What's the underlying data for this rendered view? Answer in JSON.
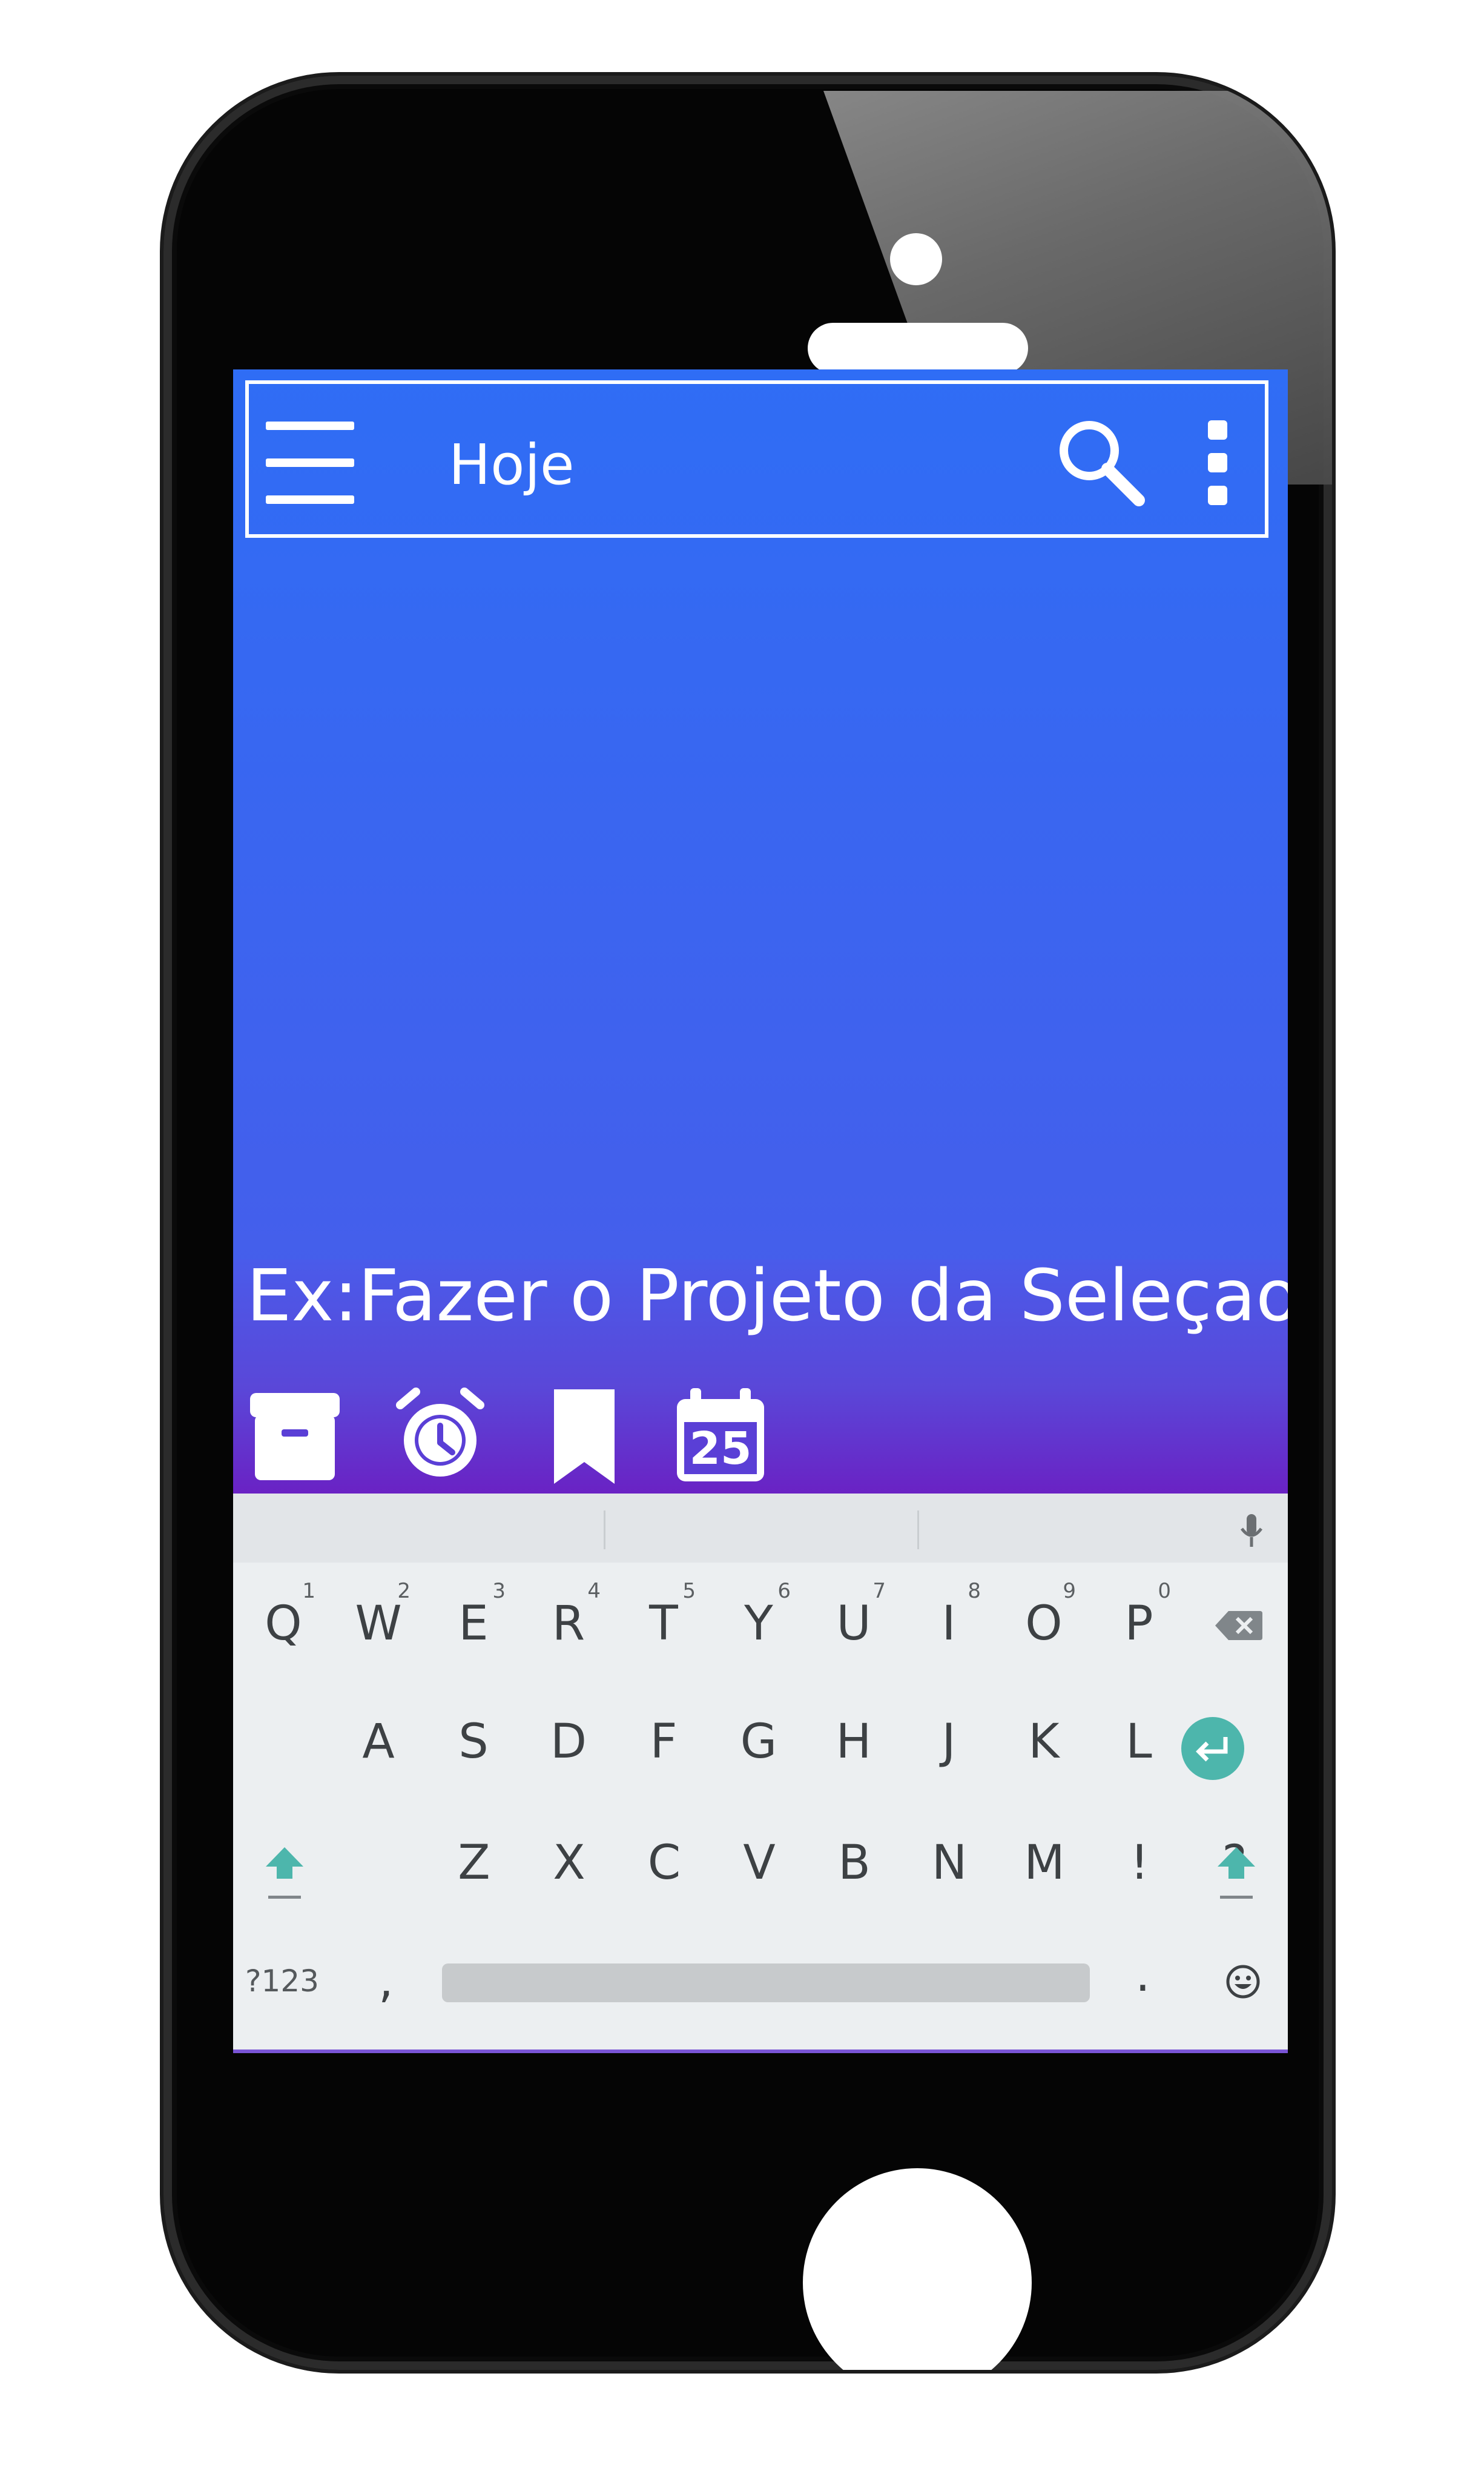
{
  "app_bar": {
    "title": "Hoje"
  },
  "task": {
    "text": "Ex:Fazer o Projeto da Seleçao"
  },
  "actions": {
    "calendar_day": "25"
  },
  "keyboard": {
    "row1": [
      {
        "label": "Q",
        "hint": "1"
      },
      {
        "label": "W",
        "hint": "2"
      },
      {
        "label": "E",
        "hint": "3"
      },
      {
        "label": "R",
        "hint": "4"
      },
      {
        "label": "T",
        "hint": "5"
      },
      {
        "label": "Y",
        "hint": "6"
      },
      {
        "label": "U",
        "hint": "7"
      },
      {
        "label": "I",
        "hint": "8"
      },
      {
        "label": "O",
        "hint": "9"
      },
      {
        "label": "P",
        "hint": "0"
      }
    ],
    "row2": [
      "A",
      "S",
      "D",
      "F",
      "G",
      "H",
      "J",
      "K",
      "L"
    ],
    "row3": [
      "Z",
      "X",
      "C",
      "V",
      "B",
      "N",
      "M",
      "!",
      "?"
    ],
    "symbols_label": "?123",
    "comma": ",",
    "period": ".",
    "accent_color": "#4db6ac"
  },
  "icons": {
    "menu": "hamburger-menu-icon",
    "search": "search-icon",
    "more": "more-vertical-icon",
    "archive": "archive-icon",
    "alarm": "alarm-icon",
    "bookmark": "bookmark-icon",
    "calendar": "calendar-icon",
    "mic": "mic-icon",
    "backspace": "backspace-icon",
    "enter": "enter-icon",
    "shift": "shift-icon",
    "emoji": "emoji-icon"
  }
}
